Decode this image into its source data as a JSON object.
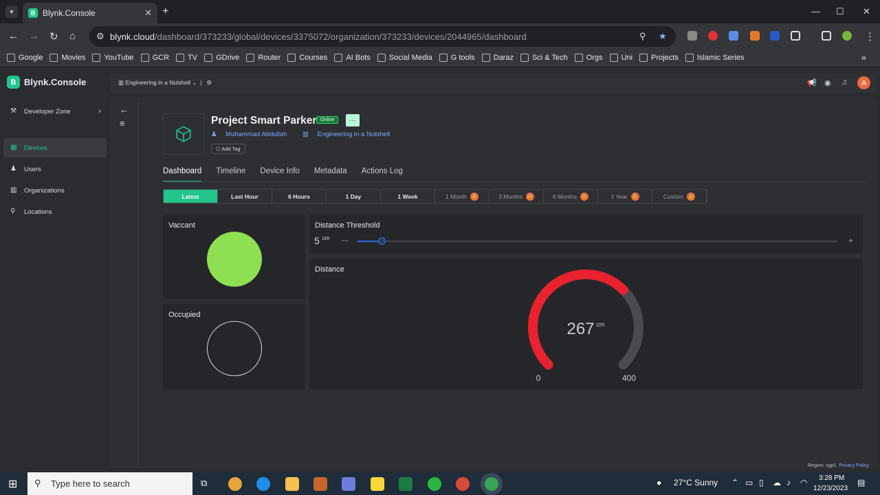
{
  "browser": {
    "tab_title": "Blynk.Console",
    "url_host": "blynk.cloud",
    "url_path": "/dashboard/373233/global/devices/3375072/organization/373233/devices/2044965/dashboard",
    "bookmarks": [
      "Google",
      "Movies",
      "YouTube",
      "GCR",
      "TV",
      "GDrive",
      "Router",
      "Courses",
      "AI Bots",
      "Social Media",
      "G tools",
      "Daraz",
      "Sci & Tech",
      "Orgs",
      "Uni",
      "Projects",
      "Islamic Series"
    ]
  },
  "app": {
    "brand": "Blynk.Console",
    "org_switch": "Engineering in a Nutshell",
    "sidebar": [
      {
        "label": "Developer Zone"
      },
      {
        "label": "Devices"
      },
      {
        "label": "Users"
      },
      {
        "label": "Organizations"
      },
      {
        "label": "Locations"
      }
    ],
    "avatar_initial": "A"
  },
  "device": {
    "title": "Project Smart Parker",
    "status": "Online",
    "more": "···",
    "owner": "Muhammad Abdullah",
    "organization": "Engineering in a Nutshell",
    "add_tag": "Add Tag"
  },
  "tabs": [
    "Dashboard",
    "Timeline",
    "Device Info",
    "Metadata",
    "Actions Log"
  ],
  "ranges": [
    {
      "label": "Latest",
      "state": "active"
    },
    {
      "label": "Last Hour",
      "state": "normal"
    },
    {
      "label": "6 Hours",
      "state": "normal"
    },
    {
      "label": "1 Day",
      "state": "normal"
    },
    {
      "label": "1 Week",
      "state": "normal"
    },
    {
      "label": "1 Month",
      "state": "locked"
    },
    {
      "label": "3 Months",
      "state": "locked"
    },
    {
      "label": "6 Months",
      "state": "locked"
    },
    {
      "label": "1 Year",
      "state": "locked"
    },
    {
      "label": "Custom",
      "state": "locked"
    }
  ],
  "widgets": {
    "vaccant": {
      "title": "Vaccant",
      "on": true,
      "color": "#8ee052"
    },
    "occupied": {
      "title": "Occupied",
      "on": false
    },
    "threshold": {
      "title": "Distance Threshold",
      "value": "5",
      "unit": "cm",
      "min": 0,
      "max": 100,
      "minus": "—",
      "plus": "+"
    },
    "distance": {
      "title": "Distance",
      "value": "267",
      "unit": "cm",
      "min": "0",
      "max": "400",
      "color": "#e8222e"
    }
  },
  "footer": {
    "region": "Region: sgp1",
    "privacy": "Privacy Policy"
  },
  "taskbar": {
    "search_placeholder": "Type here to search",
    "weather": "27°C  Sunny",
    "time": "3:28 PM",
    "date": "12/23/2023"
  }
}
